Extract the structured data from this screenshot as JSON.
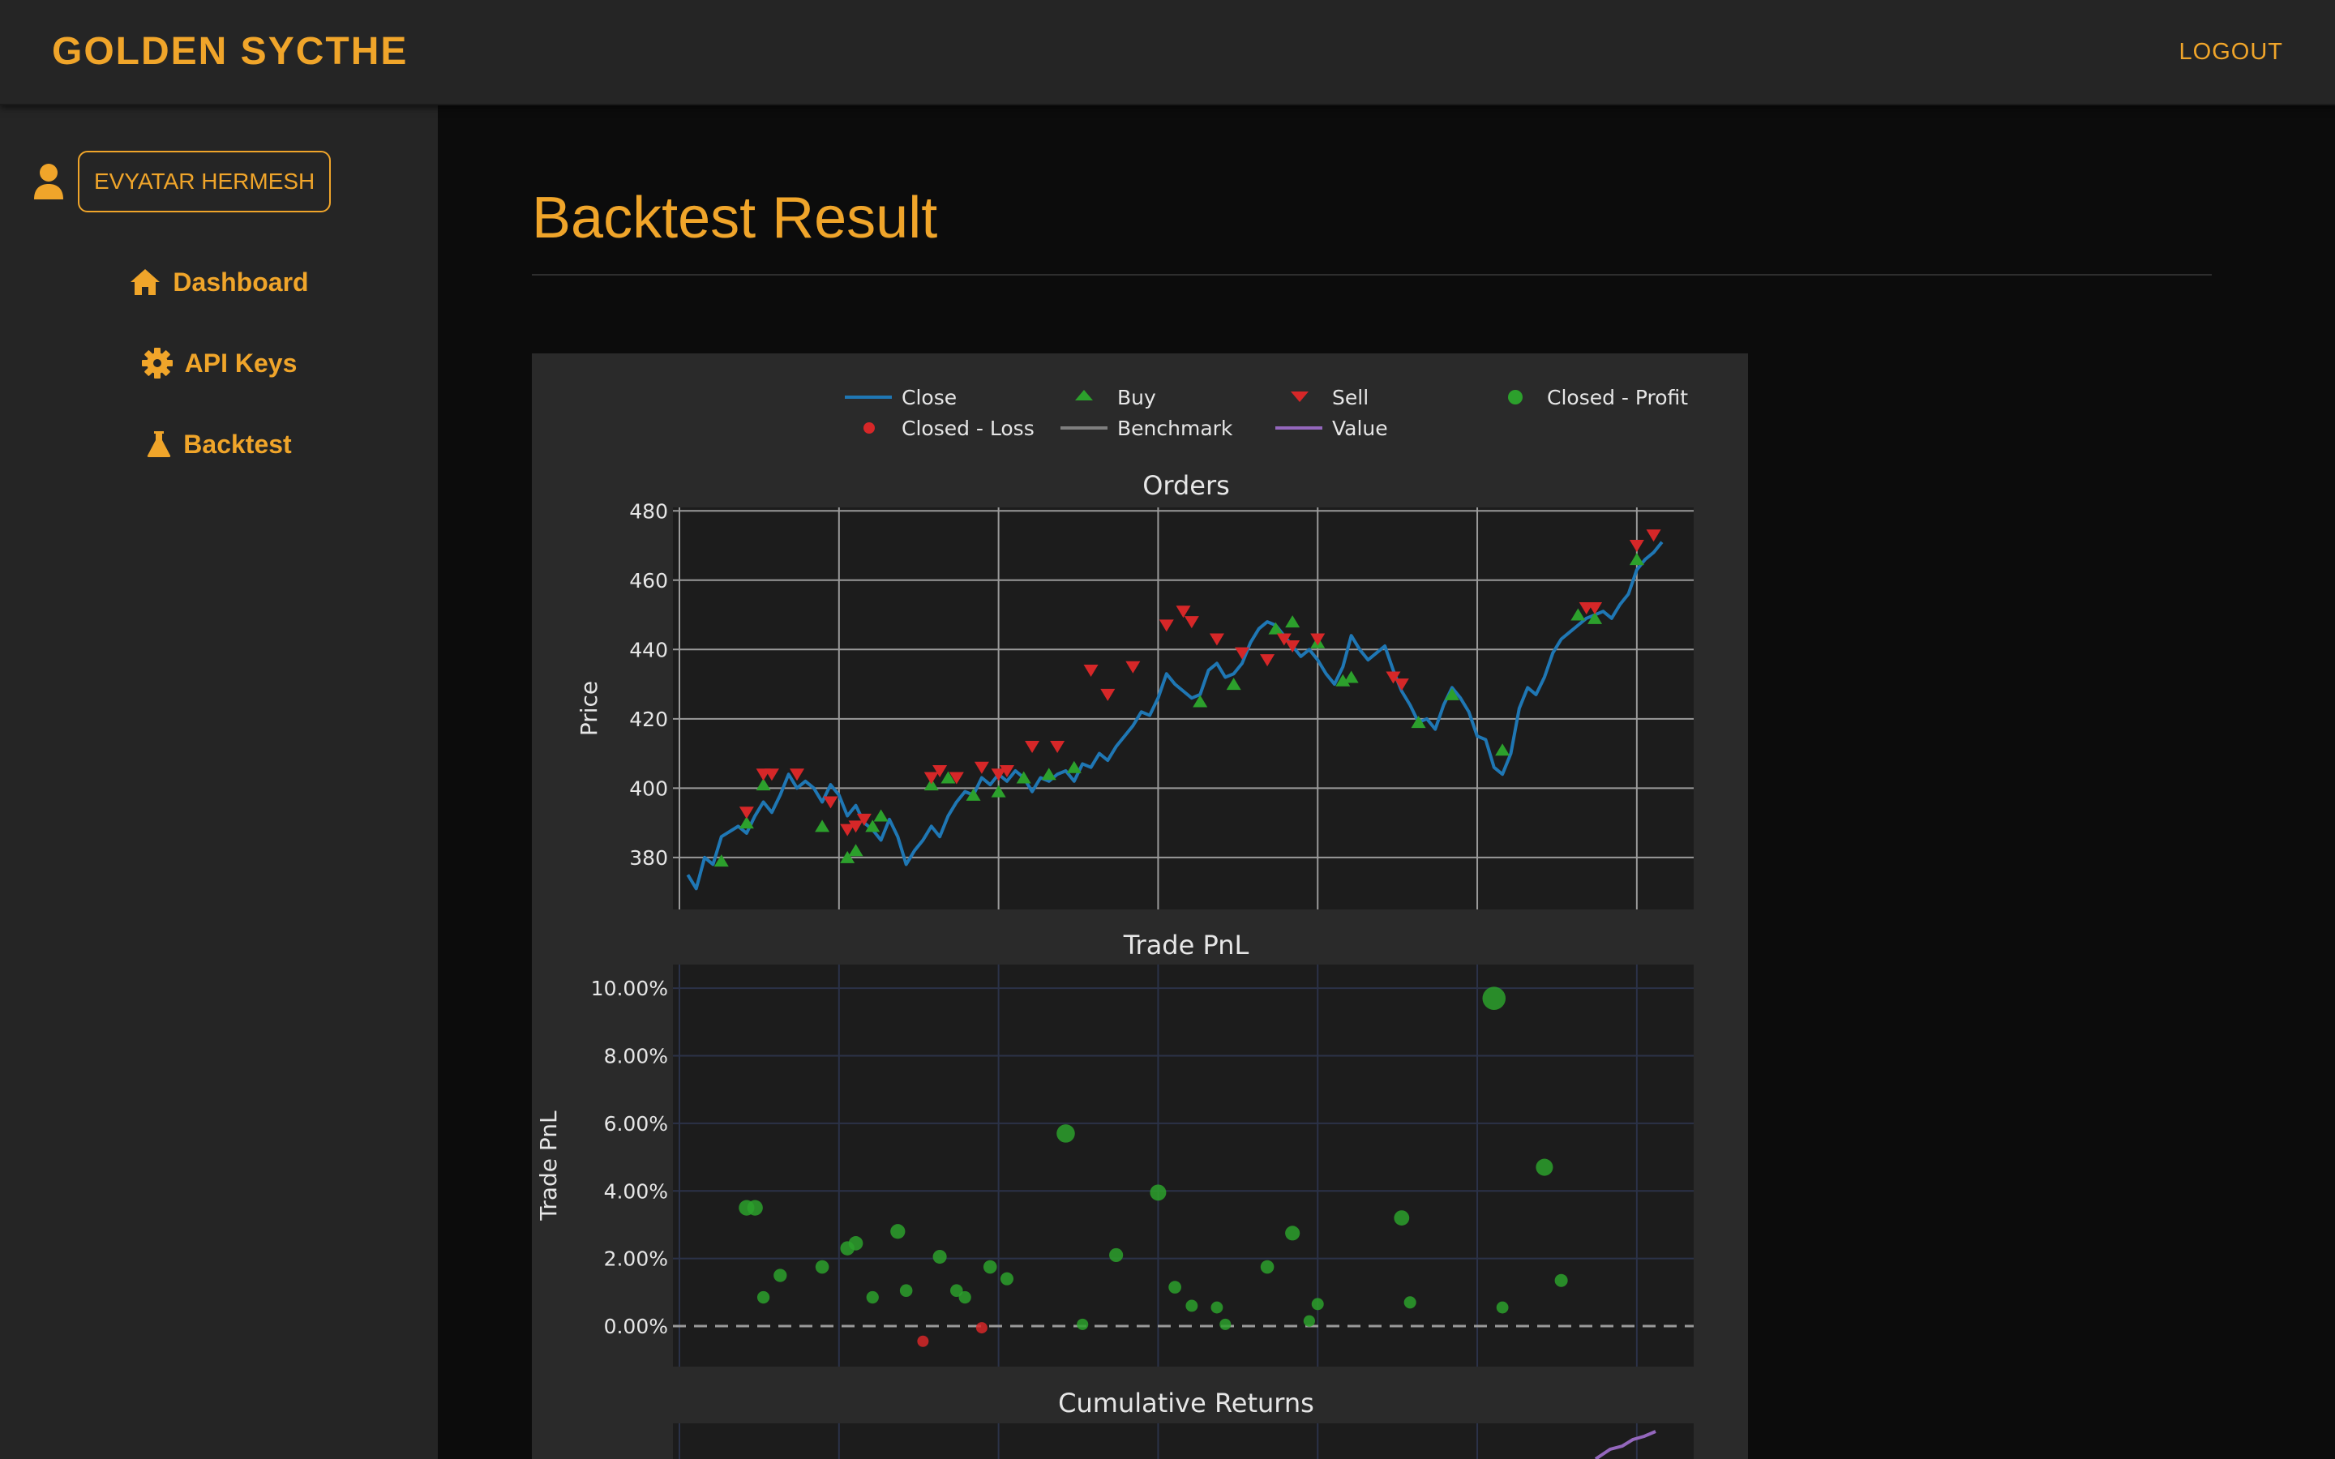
{
  "header": {
    "brand": "GOLDEN SYCTHE",
    "logout_label": "LOGOUT"
  },
  "sidebar": {
    "user_name": "EVYATAR HERMESH",
    "items": [
      {
        "label": "Dashboard",
        "icon": "home-icon"
      },
      {
        "label": "API Keys",
        "icon": "gear-icon"
      },
      {
        "label": "Backtest",
        "icon": "flask-icon"
      }
    ]
  },
  "main": {
    "title": "Backtest Result"
  },
  "colors": {
    "accent": "#f0a52a",
    "close_line": "#1f77b4",
    "buy": "#2ca02c",
    "sell": "#d62728",
    "profit": "#2ca02c",
    "loss": "#d62728",
    "benchmark": "#7f7f7f",
    "value": "#9467bd"
  },
  "chart_data": {
    "type": "line",
    "legend": {
      "placement": "top",
      "entries": [
        {
          "name": "Close",
          "marker": "line",
          "color": "#1f77b4"
        },
        {
          "name": "Buy",
          "marker": "triangle-up",
          "color": "#2ca02c"
        },
        {
          "name": "Sell",
          "marker": "triangle-down",
          "color": "#d62728"
        },
        {
          "name": "Closed - Profit",
          "marker": "circle",
          "color": "#2ca02c"
        },
        {
          "name": "Closed - Loss",
          "marker": "circle",
          "color": "#d62728"
        },
        {
          "name": "Benchmark",
          "marker": "line",
          "color": "#7f7f7f"
        },
        {
          "name": "Value",
          "marker": "line",
          "color": "#9467bd"
        }
      ]
    },
    "orders": {
      "title": "Orders",
      "ylabel": "Price",
      "ylim": [
        365,
        481
      ],
      "xlim": [
        0,
        1
      ],
      "yticks": [
        380,
        400,
        420,
        440,
        460,
        480
      ],
      "close": [
        [
          0.01,
          375
        ],
        [
          0.02,
          371
        ],
        [
          0.03,
          380
        ],
        [
          0.04,
          378
        ],
        [
          0.05,
          386
        ],
        [
          0.07,
          389
        ],
        [
          0.08,
          387
        ],
        [
          0.09,
          392
        ],
        [
          0.1,
          396
        ],
        [
          0.11,
          393
        ],
        [
          0.12,
          398
        ],
        [
          0.13,
          404
        ],
        [
          0.14,
          400
        ],
        [
          0.15,
          402
        ],
        [
          0.16,
          400
        ],
        [
          0.17,
          396
        ],
        [
          0.18,
          401
        ],
        [
          0.19,
          398
        ],
        [
          0.2,
          392
        ],
        [
          0.21,
          395
        ],
        [
          0.22,
          390
        ],
        [
          0.23,
          388
        ],
        [
          0.24,
          385
        ],
        [
          0.25,
          391
        ],
        [
          0.26,
          386
        ],
        [
          0.27,
          378
        ],
        [
          0.28,
          382
        ],
        [
          0.29,
          385
        ],
        [
          0.3,
          389
        ],
        [
          0.31,
          386
        ],
        [
          0.32,
          392
        ],
        [
          0.33,
          396
        ],
        [
          0.34,
          399
        ],
        [
          0.35,
          398
        ],
        [
          0.36,
          403
        ],
        [
          0.37,
          401
        ],
        [
          0.38,
          404
        ],
        [
          0.39,
          402
        ],
        [
          0.4,
          405
        ],
        [
          0.41,
          403
        ],
        [
          0.42,
          399
        ],
        [
          0.43,
          403
        ],
        [
          0.44,
          402
        ],
        [
          0.45,
          404
        ],
        [
          0.46,
          405
        ],
        [
          0.47,
          402
        ],
        [
          0.48,
          407
        ],
        [
          0.49,
          406
        ],
        [
          0.5,
          410
        ],
        [
          0.51,
          408
        ],
        [
          0.52,
          412
        ],
        [
          0.53,
          415
        ],
        [
          0.54,
          418
        ],
        [
          0.55,
          422
        ],
        [
          0.56,
          421
        ],
        [
          0.57,
          426
        ],
        [
          0.58,
          433
        ],
        [
          0.59,
          430
        ],
        [
          0.6,
          428
        ],
        [
          0.61,
          426
        ],
        [
          0.62,
          427
        ],
        [
          0.63,
          434
        ],
        [
          0.64,
          436
        ],
        [
          0.65,
          432
        ],
        [
          0.66,
          433
        ],
        [
          0.67,
          436
        ],
        [
          0.68,
          442
        ],
        [
          0.69,
          446
        ],
        [
          0.7,
          448
        ],
        [
          0.71,
          447
        ],
        [
          0.72,
          444
        ],
        [
          0.73,
          441
        ],
        [
          0.74,
          438
        ],
        [
          0.75,
          440
        ],
        [
          0.76,
          437
        ],
        [
          0.77,
          433
        ],
        [
          0.78,
          430
        ],
        [
          0.79,
          435
        ],
        [
          0.8,
          444
        ],
        [
          0.81,
          440
        ],
        [
          0.82,
          437
        ],
        [
          0.83,
          439
        ],
        [
          0.84,
          441
        ],
        [
          0.85,
          434
        ],
        [
          0.86,
          428
        ],
        [
          0.87,
          424
        ],
        [
          0.88,
          419
        ],
        [
          0.89,
          420
        ],
        [
          0.9,
          417
        ],
        [
          0.91,
          424
        ],
        [
          0.92,
          429
        ],
        [
          0.93,
          426
        ],
        [
          0.94,
          422
        ],
        [
          0.95,
          415
        ],
        [
          0.96,
          414
        ],
        [
          0.97,
          406
        ],
        [
          0.98,
          404
        ],
        [
          0.99,
          410
        ],
        [
          1.0,
          423
        ],
        [
          1.01,
          429
        ],
        [
          1.02,
          427
        ],
        [
          1.03,
          432
        ],
        [
          1.04,
          439
        ],
        [
          1.05,
          443
        ],
        [
          1.06,
          445
        ],
        [
          1.07,
          447
        ],
        [
          1.08,
          449
        ],
        [
          1.09,
          450
        ],
        [
          1.1,
          451
        ],
        [
          1.11,
          449
        ],
        [
          1.12,
          453
        ],
        [
          1.13,
          456
        ],
        [
          1.14,
          463
        ],
        [
          1.15,
          466
        ],
        [
          1.16,
          468
        ],
        [
          1.17,
          471
        ]
      ],
      "buys": [
        [
          0.05,
          379
        ],
        [
          0.08,
          390
        ],
        [
          0.1,
          401
        ],
        [
          0.17,
          389
        ],
        [
          0.2,
          380
        ],
        [
          0.21,
          382
        ],
        [
          0.23,
          389
        ],
        [
          0.24,
          392
        ],
        [
          0.3,
          401
        ],
        [
          0.32,
          403
        ],
        [
          0.35,
          398
        ],
        [
          0.38,
          399
        ],
        [
          0.41,
          403
        ],
        [
          0.44,
          404
        ],
        [
          0.47,
          406
        ],
        [
          0.62,
          425
        ],
        [
          0.66,
          430
        ],
        [
          0.71,
          446
        ],
        [
          0.73,
          448
        ],
        [
          0.76,
          442
        ],
        [
          0.79,
          431
        ],
        [
          0.8,
          432
        ],
        [
          0.88,
          419
        ],
        [
          0.92,
          427
        ],
        [
          0.98,
          411
        ],
        [
          1.07,
          450
        ],
        [
          1.09,
          449
        ],
        [
          1.14,
          466
        ]
      ],
      "sells": [
        [
          0.08,
          393
        ],
        [
          0.1,
          404
        ],
        [
          0.11,
          404
        ],
        [
          0.14,
          404
        ],
        [
          0.18,
          396
        ],
        [
          0.2,
          388
        ],
        [
          0.21,
          389
        ],
        [
          0.22,
          391
        ],
        [
          0.3,
          403
        ],
        [
          0.31,
          405
        ],
        [
          0.33,
          403
        ],
        [
          0.36,
          406
        ],
        [
          0.38,
          404
        ],
        [
          0.39,
          405
        ],
        [
          0.42,
          412
        ],
        [
          0.45,
          412
        ],
        [
          0.49,
          434
        ],
        [
          0.51,
          427
        ],
        [
          0.54,
          435
        ],
        [
          0.58,
          447
        ],
        [
          0.6,
          451
        ],
        [
          0.61,
          448
        ],
        [
          0.64,
          443
        ],
        [
          0.67,
          439
        ],
        [
          0.7,
          437
        ],
        [
          0.72,
          443
        ],
        [
          0.73,
          441
        ],
        [
          0.76,
          443
        ],
        [
          0.85,
          432
        ],
        [
          0.86,
          430
        ],
        [
          1.08,
          452
        ],
        [
          1.09,
          452
        ],
        [
          1.14,
          470
        ],
        [
          1.16,
          473
        ]
      ]
    },
    "pnl": {
      "title": "Trade PnL",
      "ylabel": "Trade PnL",
      "ylim": [
        -1.2,
        10.7
      ],
      "yticks": [
        "0.00%",
        "2.00%",
        "4.00%",
        "6.00%",
        "8.00%",
        "10.00%"
      ],
      "profit": [
        [
          0.08,
          3.5
        ],
        [
          0.09,
          3.5
        ],
        [
          0.1,
          0.85
        ],
        [
          0.12,
          1.5
        ],
        [
          0.17,
          1.75
        ],
        [
          0.2,
          2.3
        ],
        [
          0.21,
          2.45
        ],
        [
          0.23,
          0.85
        ],
        [
          0.26,
          2.8
        ],
        [
          0.27,
          1.05
        ],
        [
          0.31,
          2.05
        ],
        [
          0.33,
          1.05
        ],
        [
          0.34,
          0.85
        ],
        [
          0.37,
          1.75
        ],
        [
          0.39,
          1.4
        ],
        [
          0.46,
          5.7
        ],
        [
          0.48,
          0.05
        ],
        [
          0.52,
          2.1
        ],
        [
          0.57,
          3.95
        ],
        [
          0.59,
          1.15
        ],
        [
          0.61,
          0.6
        ],
        [
          0.64,
          0.55
        ],
        [
          0.65,
          0.05
        ],
        [
          0.7,
          1.75
        ],
        [
          0.73,
          2.75
        ],
        [
          0.75,
          0.15
        ],
        [
          0.76,
          0.65
        ],
        [
          0.86,
          3.2
        ],
        [
          0.87,
          0.7
        ],
        [
          0.97,
          9.7
        ],
        [
          0.98,
          0.55
        ],
        [
          1.03,
          4.7
        ],
        [
          1.05,
          1.35
        ]
      ],
      "loss": [
        [
          0.29,
          -0.45
        ],
        [
          0.36,
          -0.05
        ]
      ]
    },
    "cumulative": {
      "title": "Cumulative Returns"
    }
  }
}
